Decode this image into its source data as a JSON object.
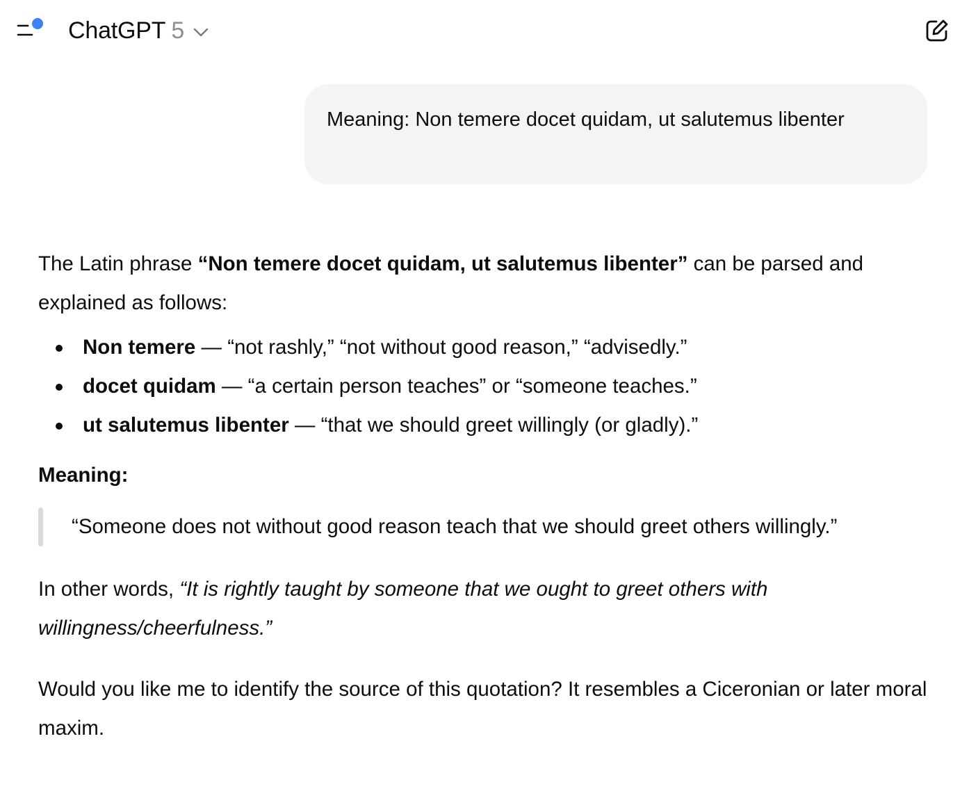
{
  "header": {
    "model_name": "ChatGPT",
    "model_version": "5",
    "sidebar_toggle_icon": "sidebar-toggle-icon",
    "new_chat_icon": "edit-icon",
    "notification_color": "#3b82f6"
  },
  "user_message": {
    "text": "Meaning: Non temere docet quidam, ut salutemus libenter"
  },
  "assistant": {
    "intro_prefix": "The Latin phrase ",
    "intro_bold": "“Non temere docet quidam, ut salutemus libenter”",
    "intro_suffix": " can be parsed and explained as follows:",
    "bullets": [
      {
        "term": "Non temere",
        "definition": " — “not rashly,” “not without good reason,” “advisedly.”"
      },
      {
        "term": "docet quidam",
        "definition": " — “a certain person teaches” or “someone teaches.”"
      },
      {
        "term": "ut salutemus libenter",
        "definition": " — “that we should greet willingly (or gladly).”"
      }
    ],
    "meaning_heading": "Meaning:",
    "quote": "“Someone does not without good reason teach that we should greet others willingly.”",
    "other_words_prefix": "In other words, ",
    "other_words_italic": "“It is rightly taught by someone that we ought to greet others with willingness/cheerfulness.”",
    "closing": "Would you like me to identify the source of this quotation? It resembles a Ciceronian or later moral maxim."
  }
}
